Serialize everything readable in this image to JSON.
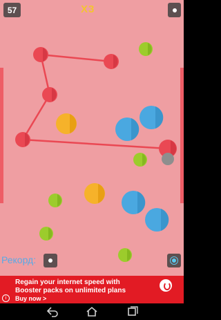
{
  "hud": {
    "score": "57",
    "multiplier": "X3",
    "pause_icon": "pause-icon",
    "record_label": "Рекорд:",
    "record_icon": "record-icon",
    "settings_icon": "settings-icon"
  },
  "colors": {
    "background": "#ef9ea2",
    "red_node": "#ea4853",
    "green_ball": "#9ccc2c",
    "orange_ball": "#f6b22a",
    "blue_ball": "#4aa8e0",
    "connector": "#ea4853",
    "gray_ball": "#8e8e8e"
  },
  "game": {
    "red_nodes": 6,
    "green_balls": 5,
    "orange_balls": 2,
    "blue_balls": 4,
    "gray_balls": 1
  },
  "ad": {
    "line1": "Regain your internet speed with",
    "line2": "Booster packs on unlimited plans",
    "cta": "Buy now >",
    "info_icon": "i"
  },
  "nav": {
    "back": "back-icon",
    "home": "home-icon",
    "recent": "recent-apps-icon"
  }
}
